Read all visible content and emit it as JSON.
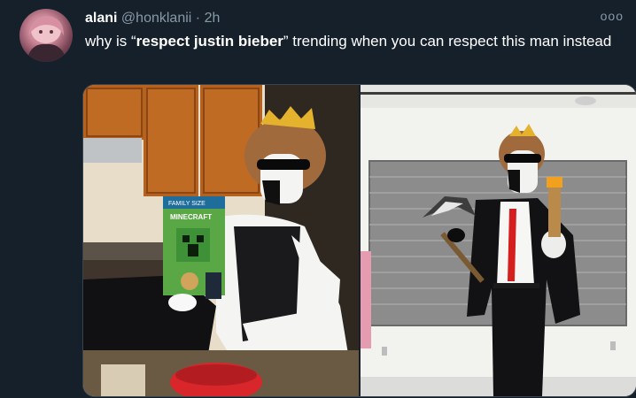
{
  "tweet": {
    "display_name": "alani",
    "handle": "@honklanii",
    "separator": "·",
    "time": "2h",
    "more_label": "ooo",
    "text": {
      "prefix": "why is “",
      "bold": "respect justin bieber",
      "suffix": "” trending when you can respect this man instead"
    }
  },
  "media": {
    "left_image": {
      "box_label_top": "FAMILY SIZE",
      "box_label_brand": "MINECRAFT"
    },
    "right_image": {}
  }
}
